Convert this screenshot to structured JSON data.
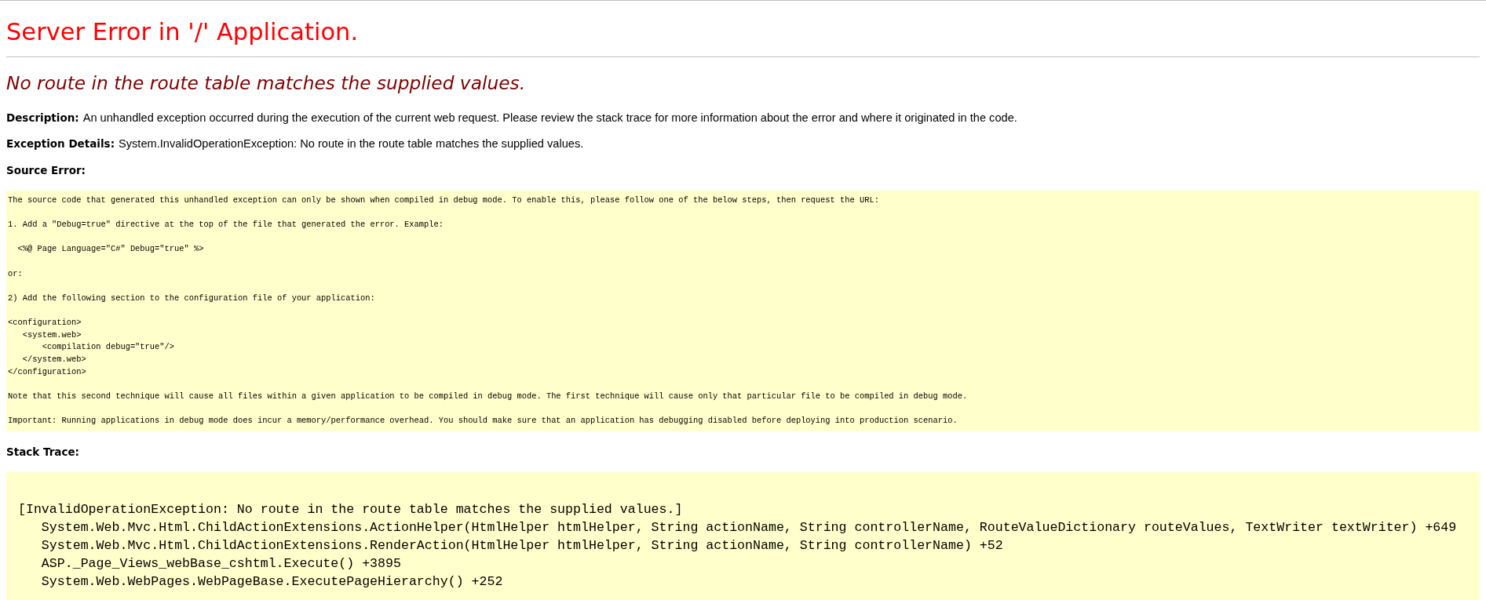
{
  "title": "Server Error in '/' Application.",
  "error_message": "No route in the route table matches the supplied values.",
  "details": [
    {
      "label": "Description:",
      "text": "An unhandled exception occurred during the execution of the current web request. Please review the stack trace for more information about the error and where it originated in the code."
    },
    {
      "label": "Exception Details:",
      "text": "System.InvalidOperationException: No route in the route table matches the supplied values."
    }
  ],
  "source_error": {
    "heading": "Source Error:",
    "blocks": [
      [
        "The source code that generated this unhandled exception can only be shown when compiled in debug mode. To enable this, please follow one of the below steps, then request the URL:"
      ],
      [
        "1. Add a \"Debug=true\" directive at the top of the file that generated the error. Example:"
      ],
      [
        "  <%@ Page Language=\"C#\" Debug=\"true\" %>"
      ],
      [
        "or:"
      ],
      [
        "2) Add the following section to the configuration file of your application:"
      ],
      [
        "<configuration>",
        "   <system.web>",
        "       <compilation debug=\"true\"/>",
        "   </system.web>",
        "</configuration>"
      ],
      [
        "Note that this second technique will cause all files within a given application to be compiled in debug mode. The first technique will cause only that particular file to be compiled in debug mode."
      ],
      [
        "Important: Running applications in debug mode does incur a memory/performance overhead. You should make sure that an application has debugging disabled before deploying into production scenario."
      ]
    ]
  },
  "stack_trace": {
    "heading": "Stack Trace:",
    "lines": [
      "[InvalidOperationException: No route in the route table matches the supplied values.]",
      "   System.Web.Mvc.Html.ChildActionExtensions.ActionHelper(HtmlHelper htmlHelper, String actionName, String controllerName, RouteValueDictionary routeValues, TextWriter textWriter) +649",
      "   System.Web.Mvc.Html.ChildActionExtensions.RenderAction(HtmlHelper htmlHelper, String actionName, String controllerName) +52",
      "   ASP._Page_Views_webBase_cshtml.Execute() +3895",
      "   System.Web.WebPages.WebPageBase.ExecutePageHierarchy() +252"
    ]
  }
}
